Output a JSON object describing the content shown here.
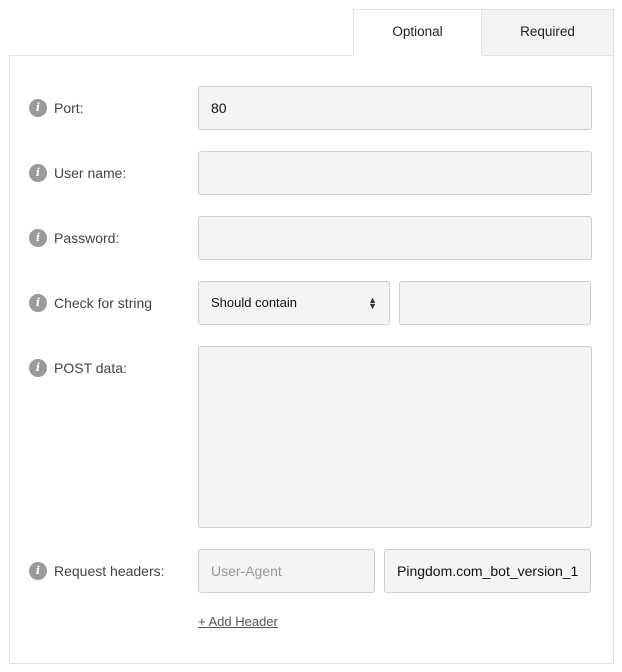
{
  "tabs": [
    {
      "label": "Optional",
      "active": true
    },
    {
      "label": "Required",
      "active": false
    }
  ],
  "fields": {
    "port": {
      "label": "Port:",
      "value": "80"
    },
    "username": {
      "label": "User name:",
      "value": ""
    },
    "password": {
      "label": "Password:",
      "value": ""
    },
    "check_string": {
      "label": "Check for string",
      "select_value": "Should contain",
      "value": ""
    },
    "post_data": {
      "label": "POST data:",
      "value": ""
    },
    "request_headers": {
      "label": "Request headers:",
      "name_placeholder": "User-Agent",
      "value": "Pingdom.com_bot_version_1"
    }
  },
  "add_header_label": "+ Add Header",
  "icons": {
    "info": "i"
  }
}
